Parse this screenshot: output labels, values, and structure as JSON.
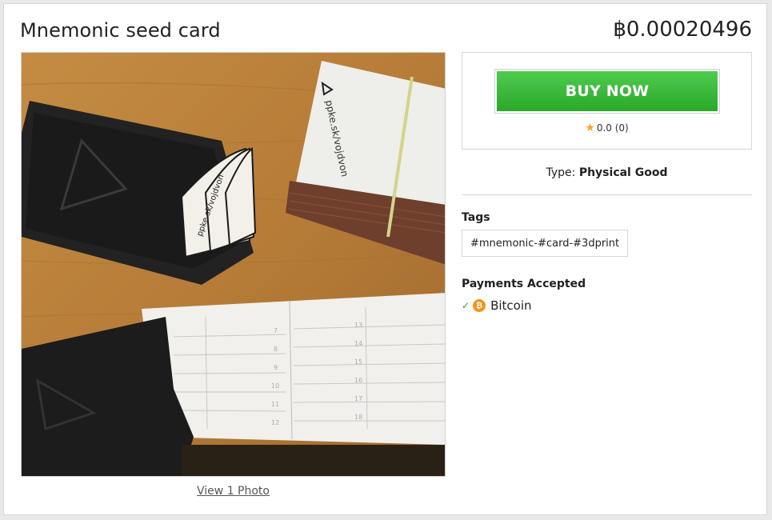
{
  "listing": {
    "title": "Mnemonic seed card",
    "price": "฿0.00020496"
  },
  "gallery": {
    "view_photos_label": "View 1 Photo",
    "card_brand_text": "ppke.sk/vojdvon",
    "grid_numbers_left": [
      "7",
      "8",
      "9",
      "10",
      "11",
      "12"
    ],
    "grid_numbers_right": [
      "13",
      "14",
      "15",
      "16",
      "17",
      "18"
    ]
  },
  "purchase": {
    "buy_label": "BUY NOW",
    "rating_value": "0.0",
    "rating_count": "(0)"
  },
  "details": {
    "type_label": "Type:",
    "type_value": "Physical Good"
  },
  "tags": {
    "heading": "Tags",
    "items": [
      "#mnemonic-#card-#3dprint"
    ]
  },
  "payments": {
    "heading": "Payments Accepted",
    "methods": [
      {
        "name": "Bitcoin",
        "icon": "bitcoin-icon",
        "accepted": true
      }
    ]
  },
  "colors": {
    "buy_button": "#36b536",
    "bitcoin": "#f7931a",
    "star": "#f5a623"
  }
}
